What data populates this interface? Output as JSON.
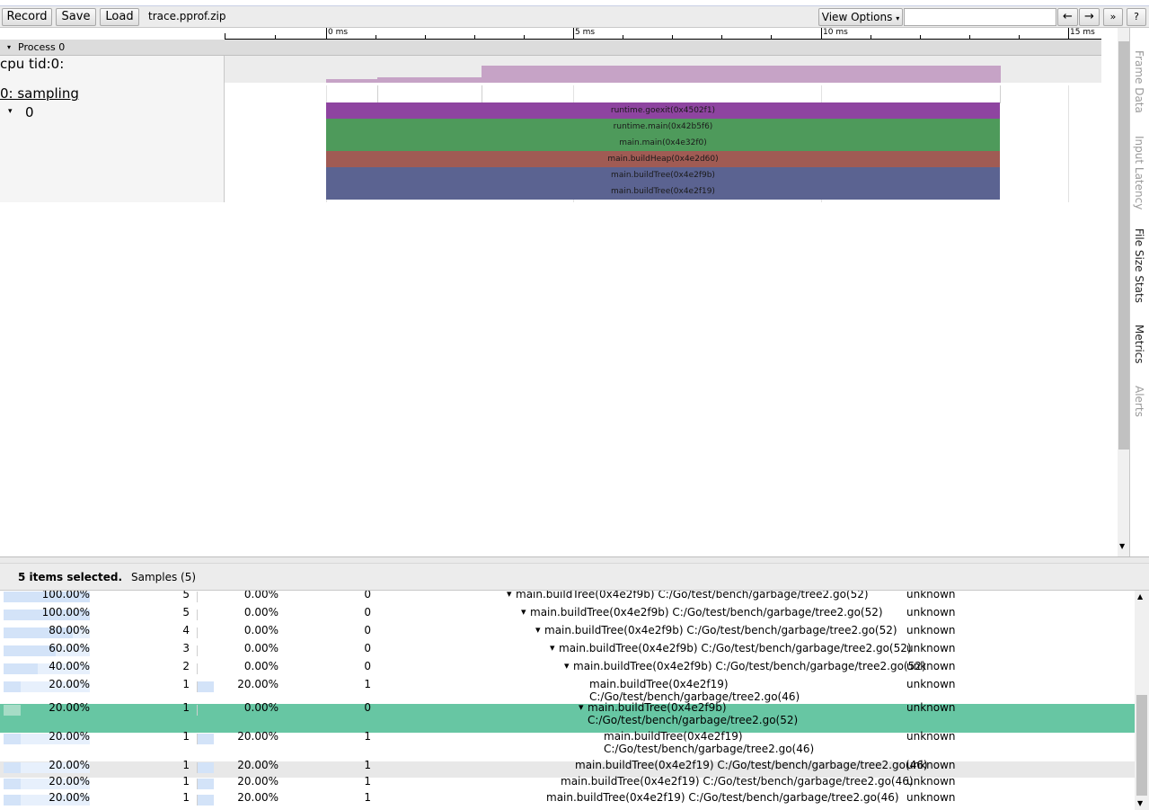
{
  "toolbar": {
    "record_label": "Record",
    "save_label": "Save",
    "load_label": "Load",
    "filename": "trace.pprof.zip",
    "view_options_label": "View Options",
    "prev_label": "←",
    "next_label": "→",
    "more_label": "»",
    "help_label": "?"
  },
  "ruler": {
    "ticks": [
      "0 ms",
      "5 ms",
      "10 ms",
      "15 ms"
    ]
  },
  "process": {
    "label": "Process 0"
  },
  "tracks": {
    "cpu_label": "cpu tid:0:",
    "sampling_label": "0: sampling",
    "thread_label": "0"
  },
  "slices": [
    {
      "name": "runtime.goexit(0x4502f1)",
      "color": "#8e44a0"
    },
    {
      "name": "runtime.main(0x42b5f6)",
      "color": "#4e9a5b"
    },
    {
      "name": "main.main(0x4e32f0)",
      "color": "#4e9a5b"
    },
    {
      "name": "main.buildHeap(0x4e2d60)",
      "color": "#a05b54"
    },
    {
      "name": "main.buildTree(0x4e2f9b)",
      "color": "#5b6391"
    },
    {
      "name": "main.buildTree(0x4e2f19)",
      "color": "#5b6391"
    }
  ],
  "side_tabs": [
    "Frame Data",
    "Input Latency",
    "File Size Stats",
    "Metrics",
    "Alerts"
  ],
  "bottom": {
    "selection_label": "5 items selected.",
    "tab_label": "Samples (5)"
  },
  "table_rows": [
    {
      "total_pct": "100.00%",
      "total": "5",
      "self_pct": "0.00%",
      "self": "0",
      "indent": 566,
      "toggle": "▾",
      "func": "main.buildTree(0x4e2f9b) C:/Go/test/bench/garbage/tree2.go(52)",
      "func2": "",
      "src": "unknown",
      "bar1": 1.0,
      "bar2": 0,
      "highlight": false,
      "grey": false
    },
    {
      "total_pct": "100.00%",
      "total": "5",
      "self_pct": "0.00%",
      "self": "0",
      "indent": 582,
      "toggle": "▾",
      "func": "main.buildTree(0x4e2f9b) C:/Go/test/bench/garbage/tree2.go(52)",
      "func2": "",
      "src": "unknown",
      "bar1": 1.0,
      "bar2": 0,
      "highlight": false,
      "grey": false
    },
    {
      "total_pct": "80.00%",
      "total": "4",
      "self_pct": "0.00%",
      "self": "0",
      "indent": 598,
      "toggle": "▾",
      "func": "main.buildTree(0x4e2f9b) C:/Go/test/bench/garbage/tree2.go(52)",
      "func2": "",
      "src": "unknown",
      "bar1": 0.8,
      "bar2": 0,
      "highlight": false,
      "grey": false
    },
    {
      "total_pct": "60.00%",
      "total": "3",
      "self_pct": "0.00%",
      "self": "0",
      "indent": 614,
      "toggle": "▾",
      "func": "main.buildTree(0x4e2f9b) C:/Go/test/bench/garbage/tree2.go(52)",
      "func2": "",
      "src": "unknown",
      "bar1": 0.6,
      "bar2": 0,
      "highlight": false,
      "grey": false
    },
    {
      "total_pct": "40.00%",
      "total": "2",
      "self_pct": "0.00%",
      "self": "0",
      "indent": 630,
      "toggle": "▾",
      "func": "main.buildTree(0x4e2f9b) C:/Go/test/bench/garbage/tree2.go(52)",
      "func2": "",
      "src": "unknown",
      "bar1": 0.4,
      "bar2": 0,
      "highlight": false,
      "grey": false
    },
    {
      "total_pct": "20.00%",
      "total": "1",
      "self_pct": "20.00%",
      "self": "1",
      "indent": 656,
      "toggle": "",
      "func": "main.buildTree(0x4e2f19)",
      "func2": "C:/Go/test/bench/garbage/tree2.go(46)",
      "src": "unknown",
      "bar1": 0.2,
      "bar2": 0.2,
      "highlight": false,
      "grey": false
    },
    {
      "total_pct": "20.00%",
      "total": "1",
      "self_pct": "0.00%",
      "self": "0",
      "indent": 646,
      "toggle": "▾",
      "func": "main.buildTree(0x4e2f9b)",
      "func2": "C:/Go/test/bench/garbage/tree2.go(52)",
      "src": "unknown",
      "bar1": 0.2,
      "bar2": 0,
      "highlight": true,
      "grey": false
    },
    {
      "total_pct": "20.00%",
      "total": "1",
      "self_pct": "20.00%",
      "self": "1",
      "indent": 672,
      "toggle": "",
      "func": "main.buildTree(0x4e2f19)",
      "func2": "C:/Go/test/bench/garbage/tree2.go(46)",
      "src": "unknown",
      "bar1": 0.2,
      "bar2": 0.2,
      "highlight": false,
      "grey": false
    },
    {
      "total_pct": "20.00%",
      "total": "1",
      "self_pct": "20.00%",
      "self": "1",
      "indent": 640,
      "toggle": "",
      "func": "main.buildTree(0x4e2f19) C:/Go/test/bench/garbage/tree2.go(46)",
      "func2": "",
      "src": "unknown",
      "bar1": 0.2,
      "bar2": 0.2,
      "highlight": false,
      "grey": true
    },
    {
      "total_pct": "20.00%",
      "total": "1",
      "self_pct": "20.00%",
      "self": "1",
      "indent": 624,
      "toggle": "",
      "func": "main.buildTree(0x4e2f19) C:/Go/test/bench/garbage/tree2.go(46)",
      "func2": "",
      "src": "unknown",
      "bar1": 0.2,
      "bar2": 0.2,
      "highlight": false,
      "grey": false
    },
    {
      "total_pct": "20.00%",
      "total": "1",
      "self_pct": "20.00%",
      "self": "1",
      "indent": 608,
      "toggle": "",
      "func": "main.buildTree(0x4e2f19) C:/Go/test/bench/garbage/tree2.go(46)",
      "func2": "",
      "src": "unknown",
      "bar1": 0.2,
      "bar2": 0.2,
      "highlight": false,
      "grey": false
    }
  ],
  "colors": {
    "selection_highlight": "#67c6a3",
    "counter_fill": "#c6a3c6",
    "accent_border": "#c7cfe4"
  }
}
